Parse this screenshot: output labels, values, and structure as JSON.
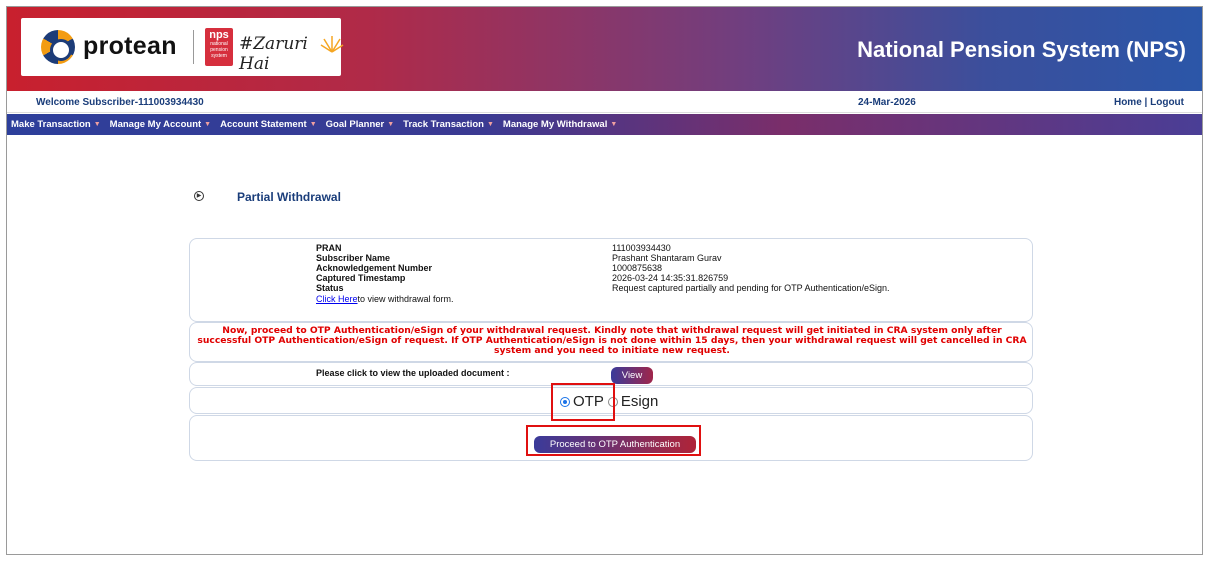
{
  "header": {
    "brand": "protean",
    "nps_badge_line1": "nps",
    "nps_badge_line2": "national pension system",
    "tagline": "#Zaruri Hai",
    "title": "National Pension System (NPS)"
  },
  "welcome_bar": {
    "welcome": "Welcome Subscriber-111003934430",
    "date": "24-Mar-2026",
    "home": "Home",
    "separator": " | ",
    "logout": "Logout"
  },
  "nav": {
    "items": [
      {
        "label": "Make Transaction"
      },
      {
        "label": "Manage My Account"
      },
      {
        "label": "Account Statement"
      },
      {
        "label": "Goal Planner"
      },
      {
        "label": "Track Transaction"
      },
      {
        "label": "Manage My Withdrawal"
      }
    ]
  },
  "page": {
    "section_title": "Partial Withdrawal"
  },
  "details": {
    "pran_label": "PRAN",
    "pran_value": "111003934430",
    "name_label": "Subscriber Name",
    "name_value": "Prashant Shantaram Gurav",
    "ack_label": "Acknowledgement Number",
    "ack_value": "1000875638",
    "ts_label": "Captured Timestamp",
    "ts_value": "2026-03-24 14:35:31.826759",
    "status_label": "Status",
    "status_value": "Request captured partially and pending for OTP Authentication/eSign.",
    "click_here": "Click Here",
    "click_suffix": "to view withdrawal form."
  },
  "notice": "Now, proceed to OTP Authentication/eSign of your withdrawal request. Kindly note that withdrawal request will get initiated in CRA system only after successful OTP Authentication/eSign of request. If OTP Authentication/eSign is not done within 15 days, then your withdrawal request will get cancelled in CRA system and you need to initiate new request.",
  "document": {
    "label": "Please click to view the uploaded document :",
    "view_button": "View"
  },
  "auth": {
    "options": [
      {
        "label": "OTP",
        "selected": true
      },
      {
        "label": "Esign",
        "selected": false
      }
    ],
    "proceed_button": "Proceed to OTP Authentication"
  },
  "colors": {
    "accent_red": "#e00000",
    "link_blue": "#1a3d7a",
    "radio_selected": "#1a73e8"
  }
}
